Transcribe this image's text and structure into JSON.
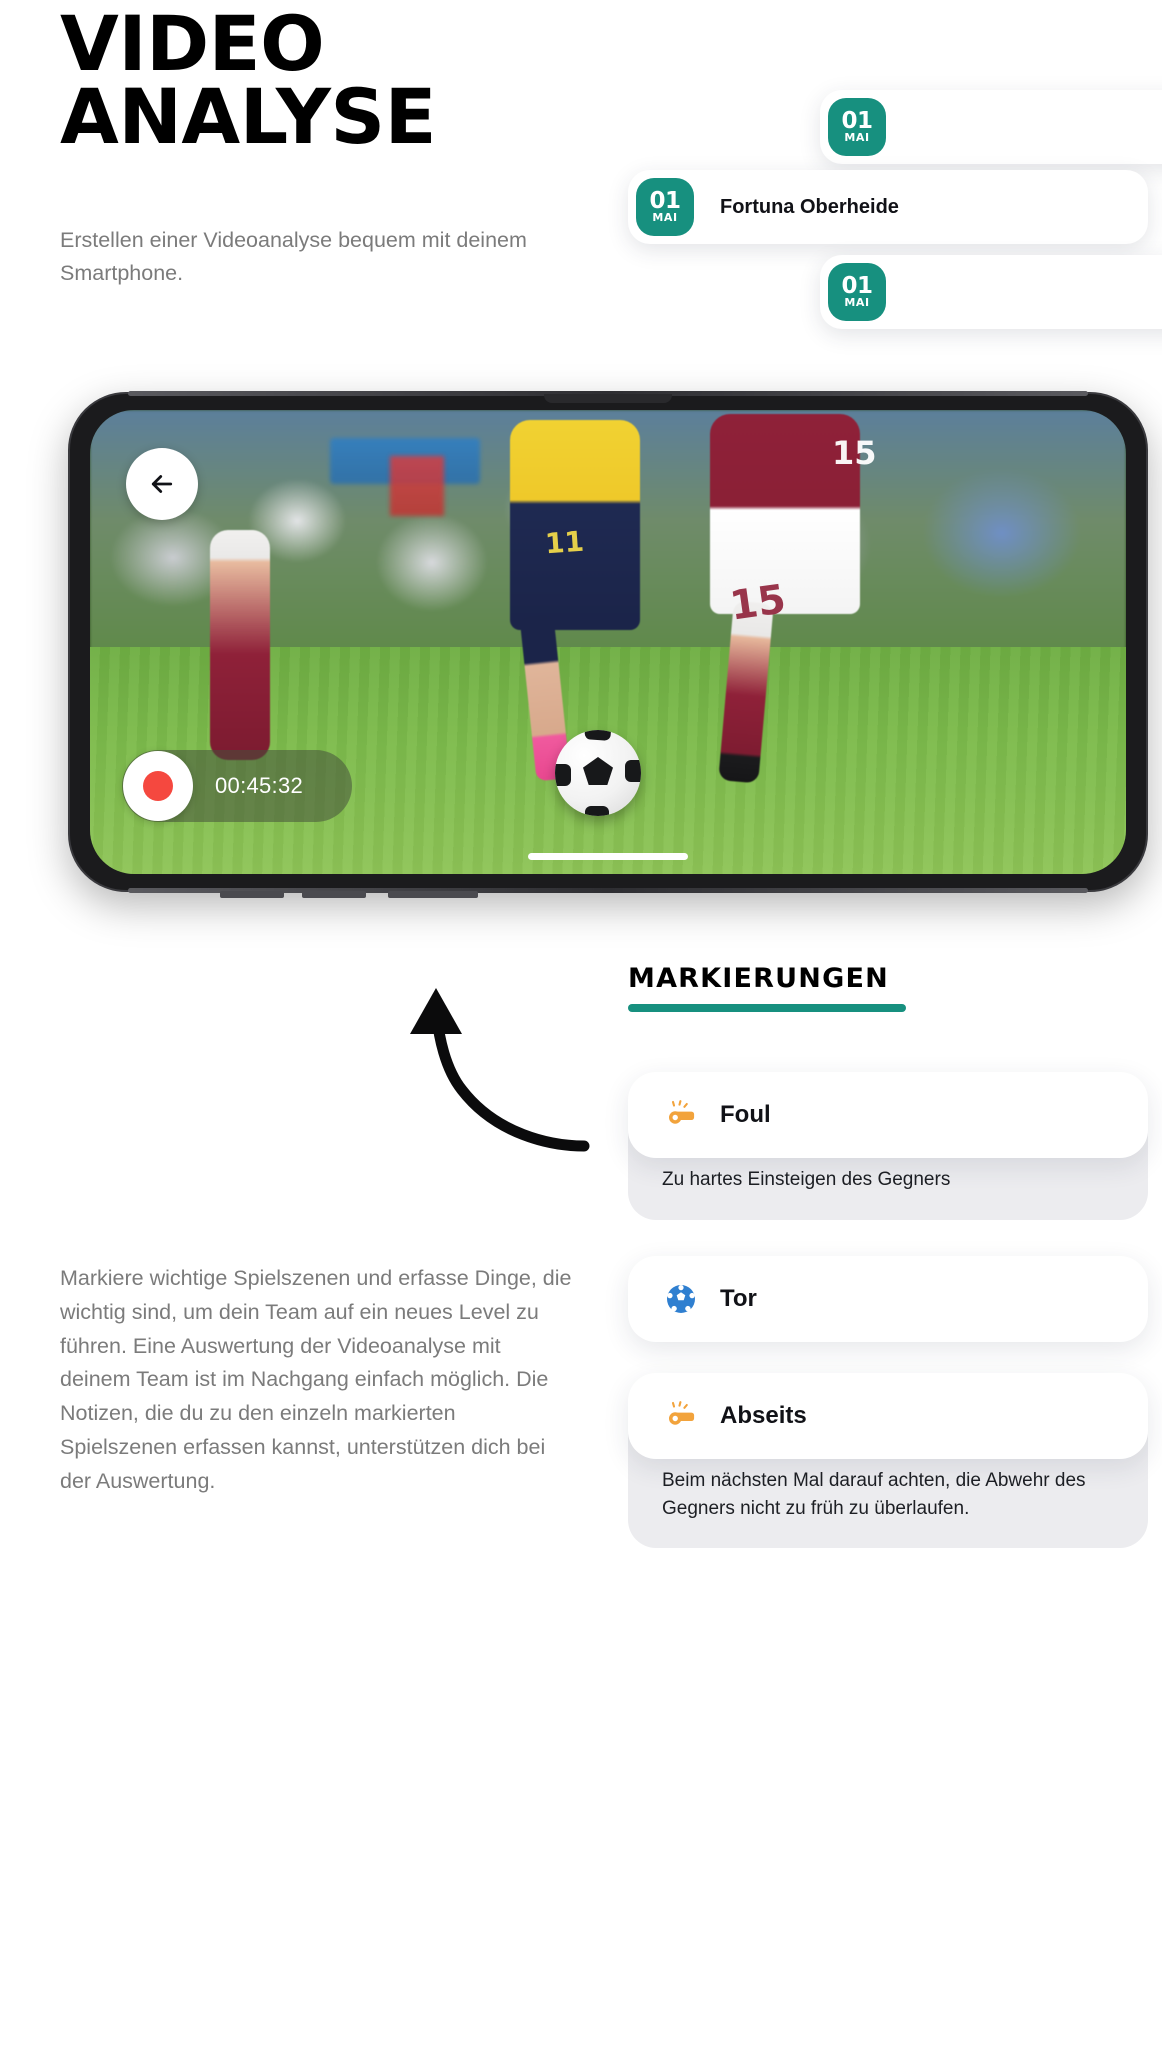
{
  "hero": {
    "title_line1": "VIDEO",
    "title_line2": "ANALYSE",
    "subtitle": "Erstellen einer Videoanalyse bequem mit deinem Smartphone."
  },
  "date_chips": [
    {
      "day": "01",
      "month": "MAI",
      "name": ""
    },
    {
      "day": "01",
      "month": "MAI",
      "name": "Fortuna Oberheide"
    },
    {
      "day": "01",
      "month": "MAI",
      "name": ""
    }
  ],
  "phone": {
    "back_icon": "arrow-left-icon",
    "record_icon": "record-dot-icon",
    "timer": "00:45:32"
  },
  "markings": {
    "heading": "MARKIERUNGEN",
    "items": [
      {
        "icon": "whistle-icon",
        "icon_color": "#f2a33c",
        "label": "Foul",
        "note": "Zu hartes Einsteigen des Gegners"
      },
      {
        "icon": "soccer-ball-icon",
        "icon_color": "#2f7fd0",
        "label": "Tor",
        "note": ""
      },
      {
        "icon": "whistle-icon",
        "icon_color": "#f2a33c",
        "label": "Abseits",
        "note": "Beim nächsten Mal darauf achten, die Abwehr des Gegners nicht zu früh zu überlaufen."
      }
    ]
  },
  "body": {
    "paragraph": "Markiere wichtige Spielszenen und erfasse Dinge, die wichtig sind, um dein Team auf ein neues Level zu führen. Eine Auswertung der Videoanalyse mit deinem Team ist im Nachgang einfach möglich. Die Notizen, die du zu den einzeln markierten Spielszenen erfassen kannst, unterstützen dich bei der Auswertung."
  },
  "colors": {
    "accent_teal": "#17907f",
    "whistle_orange": "#f2a33c",
    "ball_blue": "#2f7fd0",
    "record_red": "#f5483f",
    "muted_text": "#7b7b7b"
  }
}
